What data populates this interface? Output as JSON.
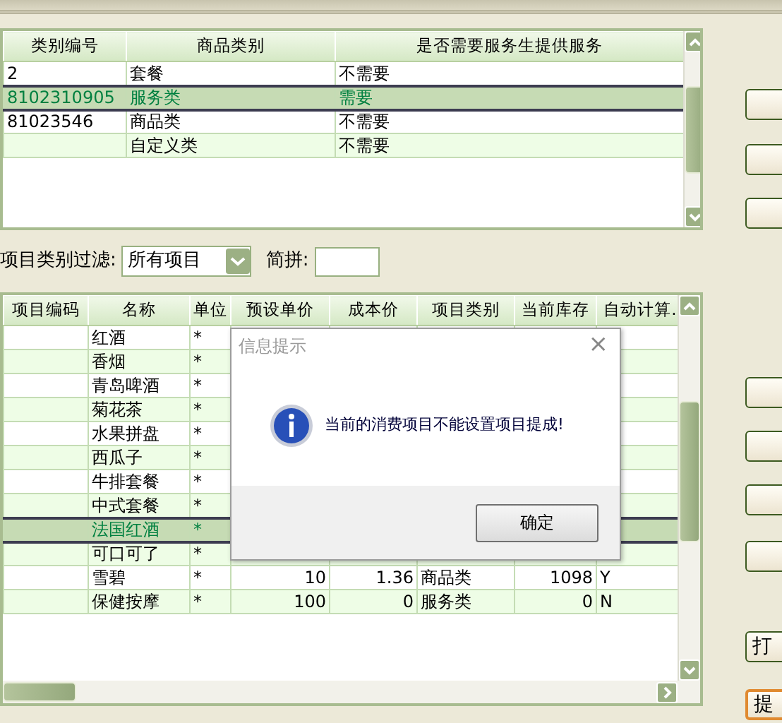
{
  "top_grid": {
    "columns": [
      "类别编号",
      "商品类别",
      "是否需要服务生提供服务"
    ],
    "rows": [
      {
        "cells": [
          "2",
          "套餐",
          "不需要"
        ],
        "selected": false
      },
      {
        "cells": [
          "8102310905",
          "服务类",
          "需要"
        ],
        "selected": true
      },
      {
        "cells": [
          "81023546",
          "商品类",
          "不需要"
        ],
        "selected": false
      },
      {
        "cells": [
          "",
          "自定义类",
          "不需要"
        ],
        "selected": false
      }
    ]
  },
  "filter": {
    "label": "项目类别过滤:",
    "value": "所有项目",
    "pinyin_label": "简拼:"
  },
  "items_grid": {
    "columns": [
      "项目编码",
      "名称",
      "单位",
      "预设单价",
      "成本价",
      "项目类别",
      "当前库存",
      "自动计算."
    ],
    "rows": [
      {
        "cells": [
          "",
          "红酒",
          "*"
        ],
        "selected": false
      },
      {
        "cells": [
          "",
          "香烟",
          "*"
        ],
        "selected": false
      },
      {
        "cells": [
          "",
          "青岛啤酒",
          "*"
        ],
        "selected": false
      },
      {
        "cells": [
          "",
          "菊花茶",
          "*"
        ],
        "selected": false
      },
      {
        "cells": [
          "",
          "水果拼盘",
          "*"
        ],
        "selected": false
      },
      {
        "cells": [
          "",
          "西瓜子",
          "*"
        ],
        "selected": false
      },
      {
        "cells": [
          "",
          "牛排套餐",
          "*"
        ],
        "selected": false
      },
      {
        "cells": [
          "",
          "中式套餐",
          "*"
        ],
        "selected": false
      },
      {
        "cells": [
          "",
          "法国红酒",
          "*"
        ],
        "selected": true
      },
      {
        "cells": [
          "",
          "可口可了",
          "*"
        ],
        "selected": false
      },
      {
        "cells": [
          "",
          "雪碧",
          "*",
          "10",
          "1.36",
          "商品类",
          "1098",
          "Y"
        ],
        "selected": false
      },
      {
        "cells": [
          "",
          "保健按摩",
          "*",
          "100",
          "0",
          "服务类",
          "0",
          "N"
        ],
        "selected": false
      }
    ]
  },
  "side_buttons": [
    {
      "focused": false
    },
    {
      "focused": false
    },
    {
      "focused": false
    },
    {
      "focused": false
    },
    {
      "focused": false
    },
    {
      "focused": false
    },
    {
      "focused": false
    },
    {
      "label": "打",
      "focused": false
    },
    {
      "label": "提",
      "focused": true
    }
  ],
  "dialog": {
    "title": "信息提示",
    "close": "×",
    "message": "当前的消费项目不能设置项目提成!",
    "ok": "确定"
  }
}
